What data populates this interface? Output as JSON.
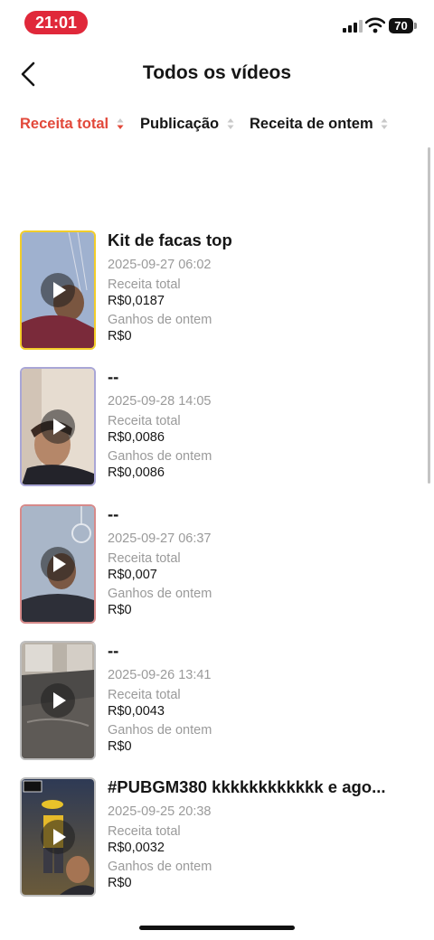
{
  "status_bar": {
    "time": "21:01",
    "battery": "70",
    "time_pill_color": "#e0283a"
  },
  "header": {
    "title": "Todos os vídeos",
    "back_icon": "chevron-left-icon"
  },
  "sort_tabs": [
    {
      "label": "Receita total",
      "active": true
    },
    {
      "label": "Publicação",
      "active": false
    },
    {
      "label": "Receita de ontem",
      "active": false
    }
  ],
  "accent_color": "#e2483a",
  "videos": [
    {
      "title": "Kit de facas top",
      "date": "2025-09-27 06:02",
      "total_label": "Receita total",
      "total_value": "R$0,0187",
      "yesterday_label": "Ganhos de ontem",
      "yesterday_value": "R$0",
      "border_color": "#f2cd2a"
    },
    {
      "title": "--",
      "date": "2025-09-28 14:05",
      "total_label": "Receita total",
      "total_value": "R$0,0086",
      "yesterday_label": "Ganhos de ontem",
      "yesterday_value": "R$0,0086",
      "border_color": "#a9a6d6"
    },
    {
      "title": "--",
      "date": "2025-09-27 06:37",
      "total_label": "Receita total",
      "total_value": "R$0,007",
      "yesterday_label": "Ganhos de ontem",
      "yesterday_value": "R$0",
      "border_color": "#d68a8a"
    },
    {
      "title": "--",
      "date": "2025-09-26 13:41",
      "total_label": "Receita total",
      "total_value": "R$0,0043",
      "yesterday_label": "Ganhos de ontem",
      "yesterday_value": "R$0",
      "border_color": "#bdbdbd"
    },
    {
      "title": "#PUBGM380 kkkkkkkkkkkk e ago...",
      "date": "2025-09-25 20:38",
      "total_label": "Receita total",
      "total_value": "R$0,0032",
      "yesterday_label": "Ganhos de ontem",
      "yesterday_value": "R$0",
      "border_color": "#bdbdbd"
    }
  ]
}
